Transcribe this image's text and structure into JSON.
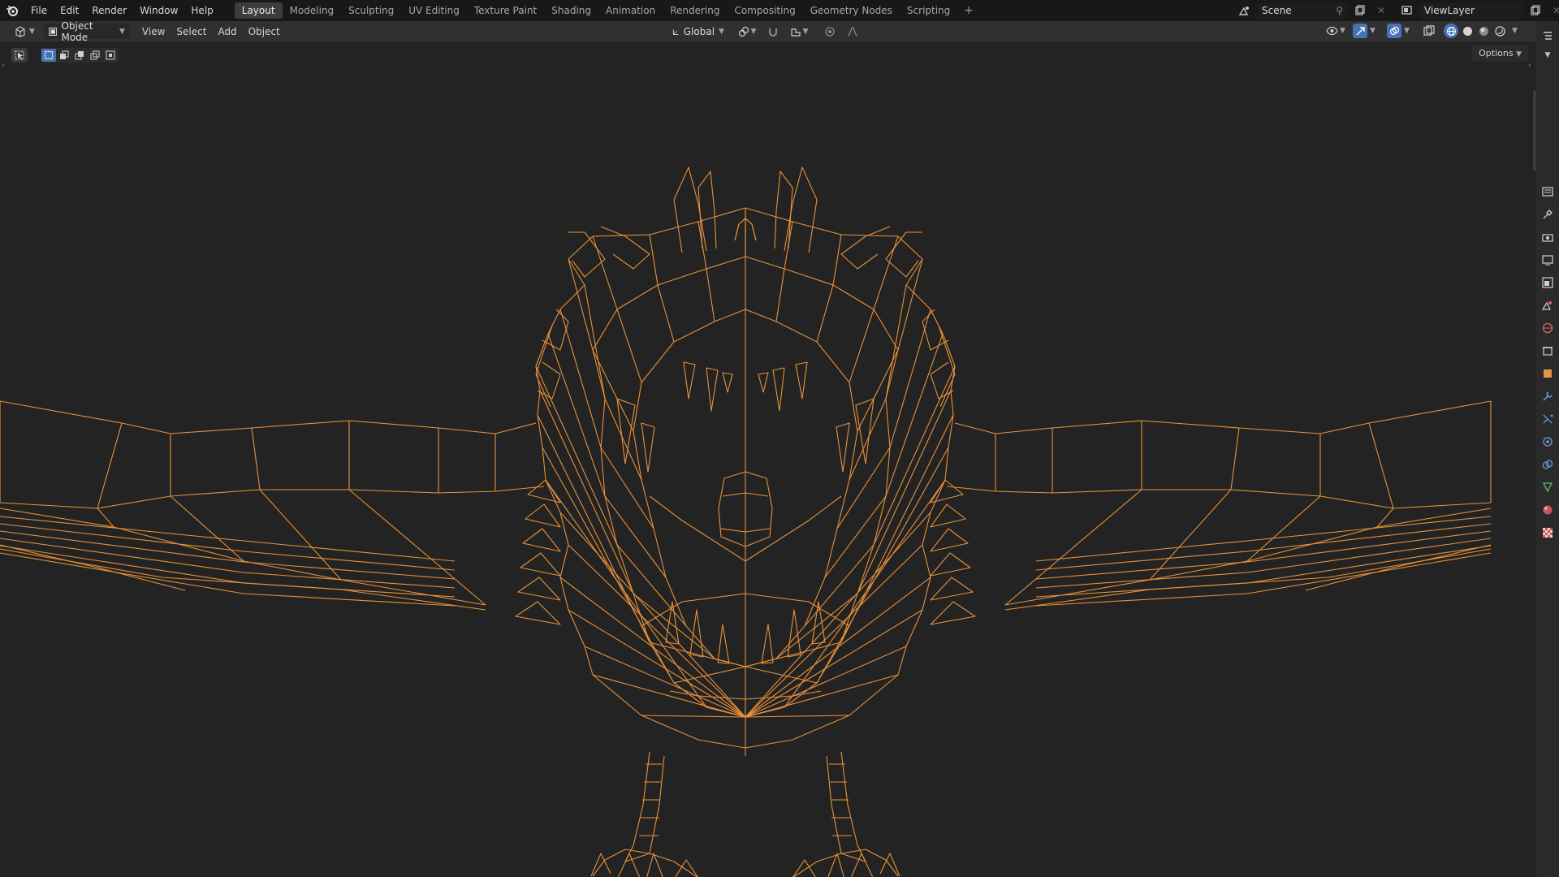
{
  "menubar": {
    "items": [
      "File",
      "Edit",
      "Render",
      "Window",
      "Help"
    ]
  },
  "workspace_tabs": [
    {
      "label": "Layout",
      "active": true
    },
    {
      "label": "Modeling",
      "active": false
    },
    {
      "label": "Sculpting",
      "active": false
    },
    {
      "label": "UV Editing",
      "active": false
    },
    {
      "label": "Texture Paint",
      "active": false
    },
    {
      "label": "Shading",
      "active": false
    },
    {
      "label": "Animation",
      "active": false
    },
    {
      "label": "Rendering",
      "active": false
    },
    {
      "label": "Compositing",
      "active": false
    },
    {
      "label": "Geometry Nodes",
      "active": false
    },
    {
      "label": "Scripting",
      "active": false
    }
  ],
  "tab_add_label": "+",
  "scene": {
    "name": "Scene"
  },
  "view_layer": {
    "name": "ViewLayer"
  },
  "header": {
    "mode": "Object Mode",
    "view": "View",
    "select": "Select",
    "add": "Add",
    "object": "Object",
    "orientation": "Global"
  },
  "viewport": {
    "options_label": "Options",
    "wire_color": "#e8913a",
    "background": "#232323"
  },
  "icons": {
    "logo": "blender-logo-icon",
    "editor_type": "3d-viewport-icon",
    "select_box": "select-box-icon",
    "pivot": "pivot-icon",
    "snap": "snap-icon",
    "proportional": "proportional-edit-icon",
    "visibility": "visibility-icon",
    "gizmo": "gizmo-icon",
    "overlay": "overlay-icon",
    "xray": "xray-icon",
    "shading": [
      "wireframe-shading-icon",
      "solid-shading-icon",
      "material-shading-icon",
      "rendered-shading-icon"
    ],
    "properties": [
      "tool-icon",
      "render-icon",
      "output-icon",
      "view-layer-icon",
      "scene-icon",
      "world-icon",
      "collection-icon",
      "object-icon",
      "modifier-icon",
      "particles-icon",
      "physics-icon",
      "constraints-icon",
      "data-icon",
      "material-icon",
      "texture-icon"
    ]
  },
  "accent": "#4772b3"
}
